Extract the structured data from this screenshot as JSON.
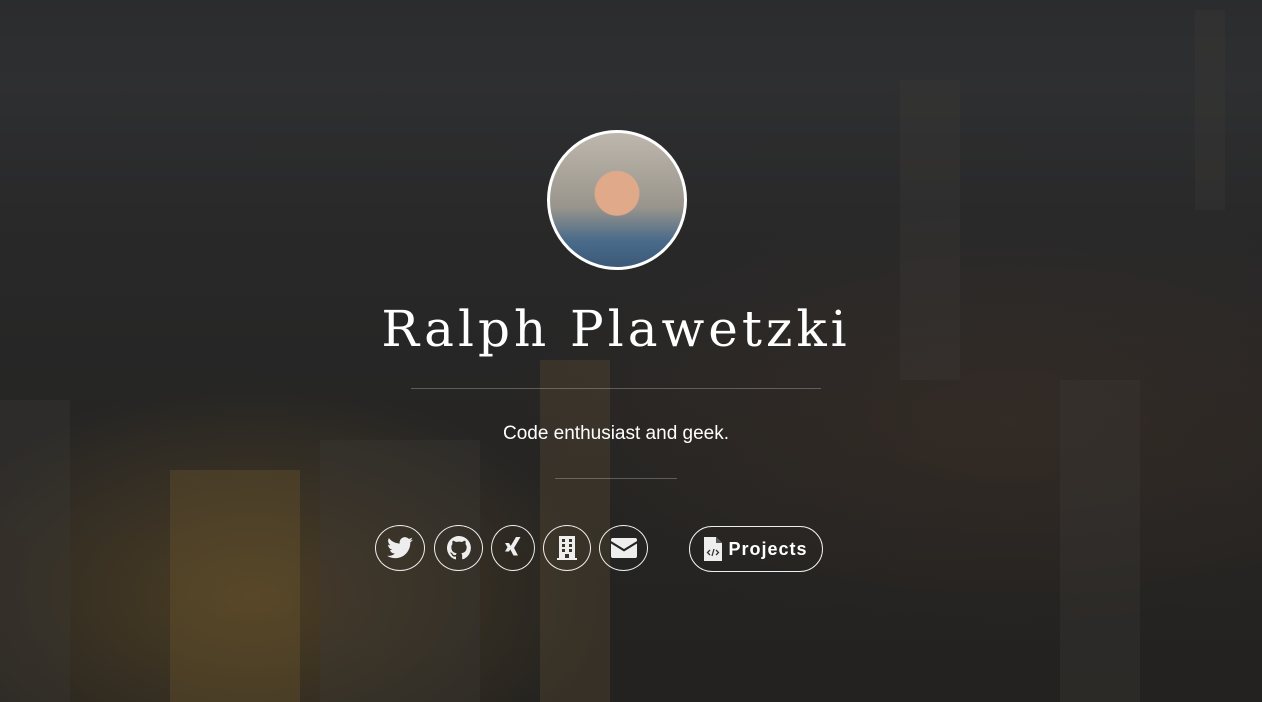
{
  "profile": {
    "name": "Ralph Plawetzki",
    "tagline": "Code enthusiast and geek."
  },
  "social": [
    {
      "icon": "twitter-icon",
      "label": "Twitter"
    },
    {
      "icon": "github-icon",
      "label": "GitHub"
    },
    {
      "icon": "xing-icon",
      "label": "Xing"
    },
    {
      "icon": "building-icon",
      "label": "Company"
    },
    {
      "icon": "envelope-icon",
      "label": "Email"
    }
  ],
  "projects_button": {
    "label": "Projects",
    "icon": "file-code-icon"
  }
}
